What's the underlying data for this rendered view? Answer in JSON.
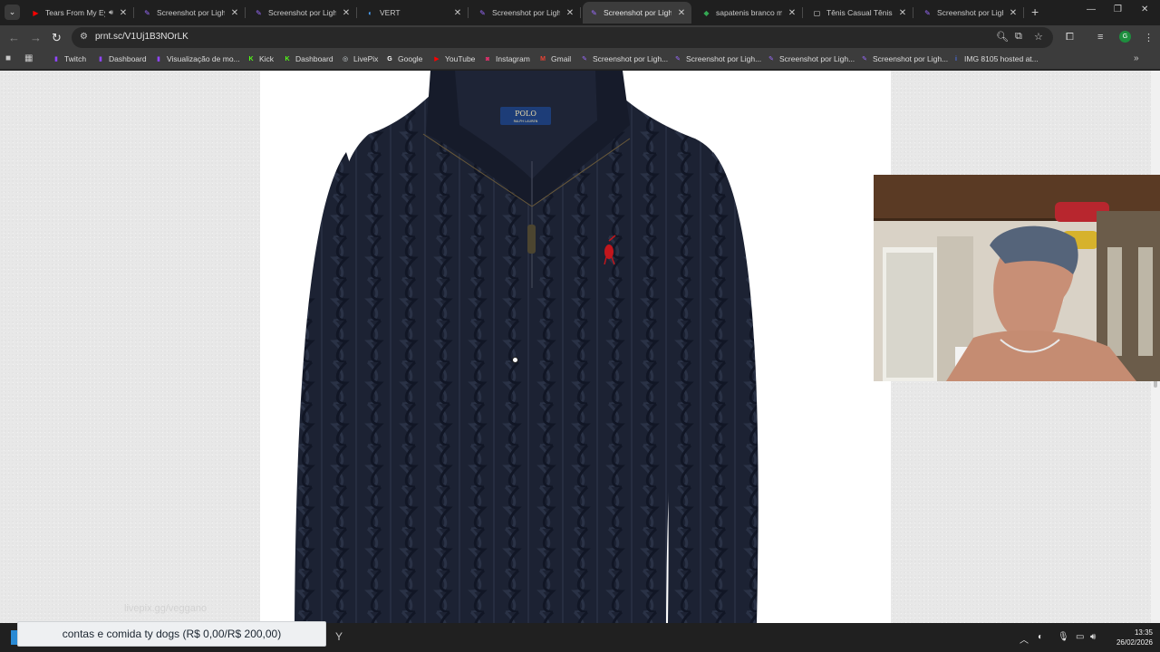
{
  "tabs": [
    {
      "title": "Tears From My Eyes",
      "fav": "youtube",
      "favColor": "#ff0000",
      "audio": true
    },
    {
      "title": "Screenshot por Lightshot",
      "fav": "lightshot",
      "favColor": "#9b6bff"
    },
    {
      "title": "Screenshot por Lightshot",
      "fav": "lightshot",
      "favColor": "#9b6bff"
    },
    {
      "title": "VERT",
      "fav": "vert",
      "favColor": "#4aa3ff"
    },
    {
      "title": "Screenshot por Lightshot",
      "fav": "lightshot",
      "favColor": "#9b6bff"
    },
    {
      "title": "Screenshot por Lightshot",
      "fav": "lightshot",
      "favColor": "#9b6bff",
      "active": true
    },
    {
      "title": "sapatenis branco masculino",
      "fav": "google-shopping",
      "favColor": "#34a853"
    },
    {
      "title": "Tênis Casual Tênis Masculino",
      "fav": "store",
      "favColor": "#dddddd"
    },
    {
      "title": "Screenshot por Lightshot",
      "fav": "lightshot",
      "favColor": "#9b6bff"
    }
  ],
  "address": {
    "url": "prnt.sc/V1Uj1B3NOrLK"
  },
  "profile": {
    "initial": "G"
  },
  "bookmarks": [
    {
      "label": "Twitch",
      "icon": "twitch",
      "color": "#9146ff"
    },
    {
      "label": "Dashboard",
      "icon": "twitch",
      "color": "#9146ff"
    },
    {
      "label": "Visualização de mo...",
      "icon": "twitch",
      "color": "#9146ff"
    },
    {
      "label": "Kick",
      "icon": "kick",
      "color": "#53fc18"
    },
    {
      "label": "Dashboard",
      "icon": "kick",
      "color": "#53fc18"
    },
    {
      "label": "LivePix",
      "icon": "livepix",
      "color": "#cfd8dc"
    },
    {
      "label": "Google",
      "icon": "google",
      "color": "#ffffff"
    },
    {
      "label": "YouTube",
      "icon": "youtube",
      "color": "#ff0000"
    },
    {
      "label": "Instagram",
      "icon": "instagram",
      "color": "#e1306c"
    },
    {
      "label": "Gmail",
      "icon": "gmail",
      "color": "#ea4335"
    },
    {
      "label": "Screenshot por Ligh...",
      "icon": "lightshot",
      "color": "#9b6bff"
    },
    {
      "label": "Screenshot por Ligh...",
      "icon": "lightshot",
      "color": "#9b6bff"
    },
    {
      "label": "Screenshot por Ligh...",
      "icon": "lightshot",
      "color": "#9b6bff"
    },
    {
      "label": "Screenshot por Ligh...",
      "icon": "lightshot",
      "color": "#9b6bff"
    },
    {
      "label": "IMG 8105 hosted at...",
      "icon": "imgbb",
      "color": "#4a6ee0"
    }
  ],
  "product": {
    "neck_label": "POLO",
    "neck_sublabel": "RALPH LAUREN",
    "color": "#1c2233"
  },
  "overlay": {
    "watermark": "livepix.gg/veggano",
    "donation": "contas e comida ty dogs (R$ 0,00/R$ 200,00)"
  },
  "clock": {
    "time": "13:35",
    "date": "26/02/2026"
  }
}
